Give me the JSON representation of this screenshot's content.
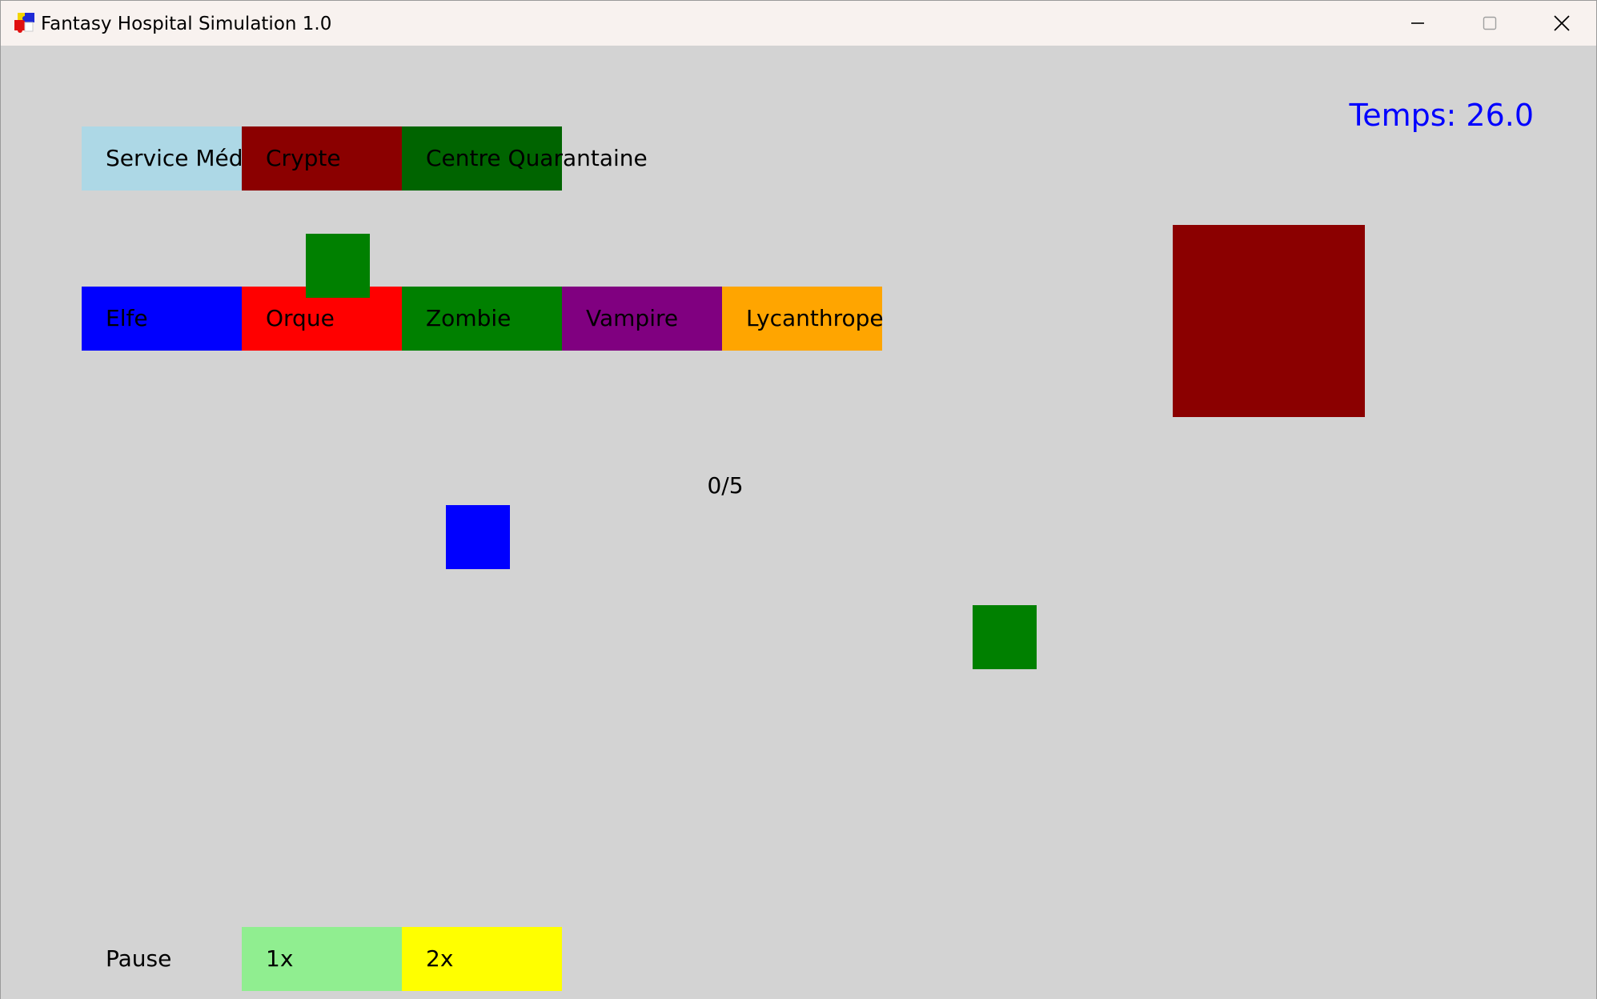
{
  "window": {
    "title": "Fantasy Hospital Simulation 1.0",
    "icon": "puzzle-app-icon",
    "controls": [
      "minimize-icon",
      "maximize-icon",
      "close-icon"
    ]
  },
  "services": [
    {
      "label": "Service Médical",
      "color": "#add8e6"
    },
    {
      "label": "Crypte",
      "color": "#8b0000"
    },
    {
      "label": "Centre Quarantaine",
      "color": "#006400"
    }
  ],
  "creatures": [
    {
      "label": "Elfe",
      "color": "#0000ff"
    },
    {
      "label": "Orque",
      "color": "#ff0000"
    },
    {
      "label": "Zombie",
      "color": "#008000"
    },
    {
      "label": "Vampire",
      "color": "#800080"
    },
    {
      "label": "Lycanthrope",
      "color": "#ffa500"
    }
  ],
  "speed_controls": [
    {
      "label": "Pause",
      "color": "#d3d3d3"
    },
    {
      "label": "1x",
      "color": "#90ee90"
    },
    {
      "label": "2x",
      "color": "#ffff00"
    }
  ],
  "hud": {
    "time_text": "Temps: 26.0",
    "time_color": "#0000ff",
    "counter_text": "0/5"
  },
  "entities": [
    {
      "name": "zombie-patient",
      "color": "#008000"
    },
    {
      "name": "elf-patient",
      "color": "#0000ff"
    },
    {
      "name": "zombie-patient",
      "color": "#008000"
    },
    {
      "name": "crypt-building",
      "color": "#8b0000"
    }
  ]
}
